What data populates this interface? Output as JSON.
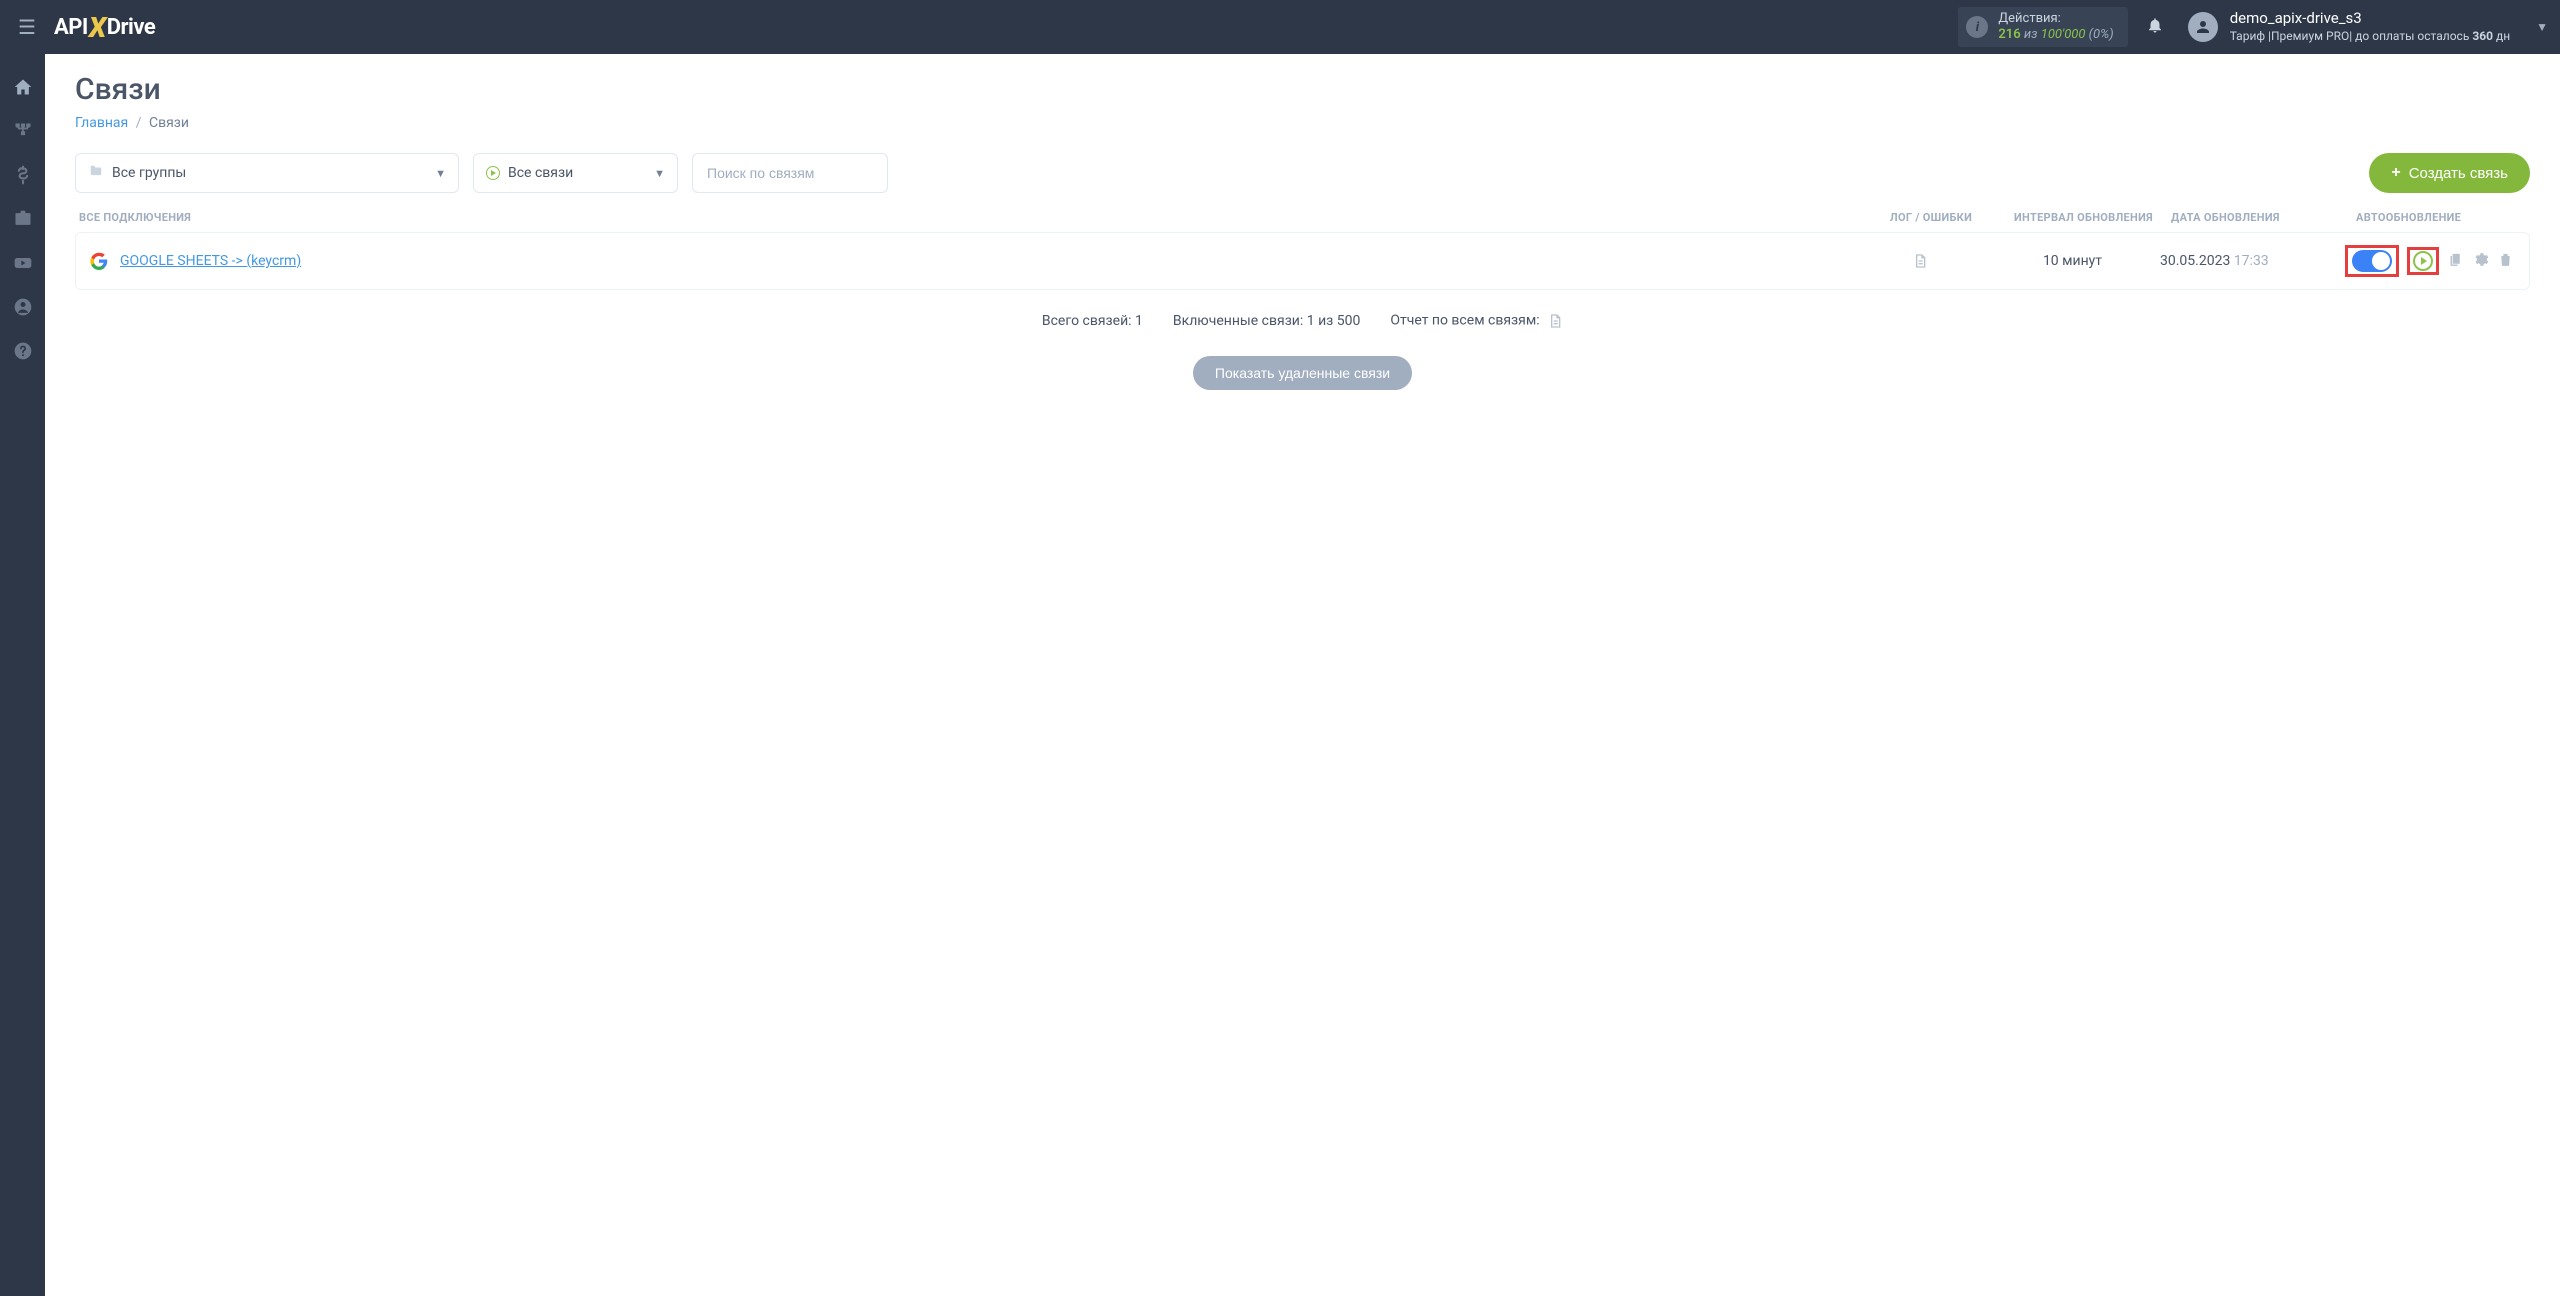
{
  "topbar": {
    "logo_api": "API",
    "logo_drive": "Drive",
    "actions_label": "Действия:",
    "actions_used": "216",
    "actions_iz": " из ",
    "actions_limit": "100'000",
    "actions_pct": " (0%)",
    "user_name": "demo_apix-drive_s3",
    "user_sub_prefix": "Тариф |Премиум PRO|  до оплаты осталось ",
    "user_sub_days": "360",
    "user_sub_suffix": " дн"
  },
  "page": {
    "title": "Связи",
    "breadcrumb_home": "Главная",
    "breadcrumb_current": "Связи"
  },
  "controls": {
    "groups_label": "Все группы",
    "conns_label": "Все связи",
    "search_placeholder": "Поиск по связям",
    "create_label": "Создать связь"
  },
  "headers": {
    "name": "ВСЕ ПОДКЛЮЧЕНИЯ",
    "log": "ЛОГ / ОШИБКИ",
    "interval": "ИНТЕРВАЛ ОБНОВЛЕНИЯ",
    "date": "ДАТА ОБНОВЛЕНИЯ",
    "auto": "АВТООБНОВЛЕНИЕ"
  },
  "row": {
    "name": "GOOGLE SHEETS -> (keycrm)",
    "interval": "10 минут",
    "date": "30.05.2023",
    "time": "17:33"
  },
  "summary": {
    "total": "Всего связей: 1",
    "enabled": "Включенные связи: 1 из 500",
    "report": "Отчет по всем связям:"
  },
  "show_deleted": "Показать удаленные связи"
}
